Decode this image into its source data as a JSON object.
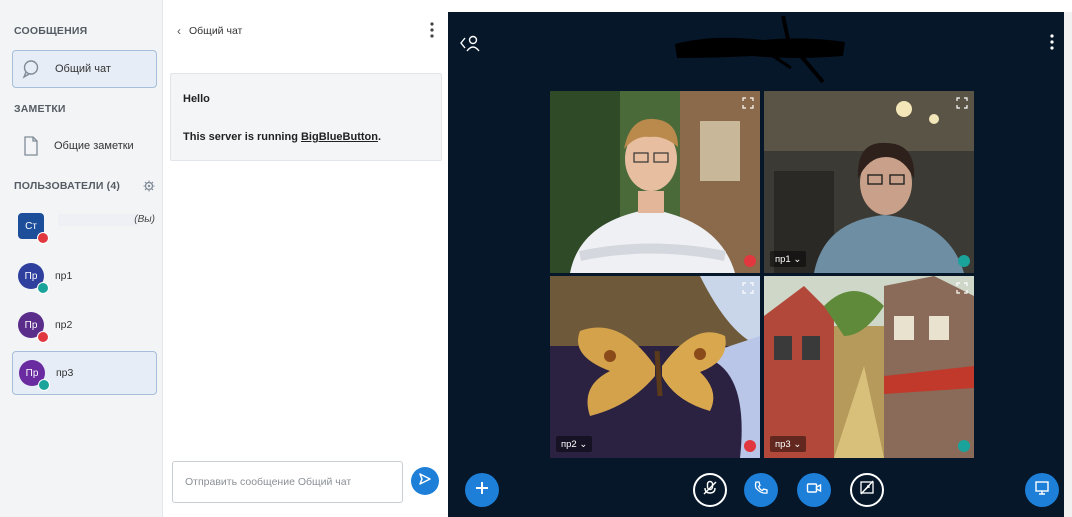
{
  "sidebar": {
    "messages_heading": "СООБЩЕНИЯ",
    "public_chat": "Общий чат",
    "notes_heading": "ЗАМЕТКИ",
    "shared_notes": "Общие заметки",
    "users_heading": "ПОЛЬЗОВАТЕЛИ (4)",
    "users": [
      {
        "initials": "Ст",
        "name": "",
        "you": "(Вы)",
        "color": "#1d4e9a",
        "badge": "muted"
      },
      {
        "initials": "Пр",
        "name": "пр1",
        "color": "#2f3f9e",
        "badge": "listen"
      },
      {
        "initials": "Пр",
        "name": "пр2",
        "color": "#5b2d8a",
        "badge": "muted"
      },
      {
        "initials": "Пр",
        "name": "пр3",
        "color": "#6a2aa0",
        "badge": "listen"
      }
    ]
  },
  "chat": {
    "title": "Общий чат",
    "message_1": "Hello",
    "message_2_prefix": "This server is running ",
    "message_2_link": "BigBlueButton",
    "message_2_suffix": ".",
    "input_placeholder": "Отправить сообщение Общий чат"
  },
  "video": {
    "tiles": [
      {
        "label": "",
        "status": "muted"
      },
      {
        "label": "пр1",
        "status": "listen"
      },
      {
        "label": "пр2",
        "status": "muted"
      },
      {
        "label": "пр3",
        "status": "listen"
      }
    ]
  },
  "colors": {
    "accent": "#1d7fd8",
    "dark_bg": "#06172a",
    "muted_badge": "#e0383e",
    "listen_badge": "#1aa39b"
  },
  "icons": [
    "chat-icon",
    "notes-icon",
    "gear-icon",
    "send-icon",
    "users-toggle-icon",
    "kebab-icon",
    "plus-icon",
    "mic-off-icon",
    "phone-icon",
    "camera-icon",
    "screenshare-off-icon",
    "presentation-icon",
    "expand-icon"
  ]
}
